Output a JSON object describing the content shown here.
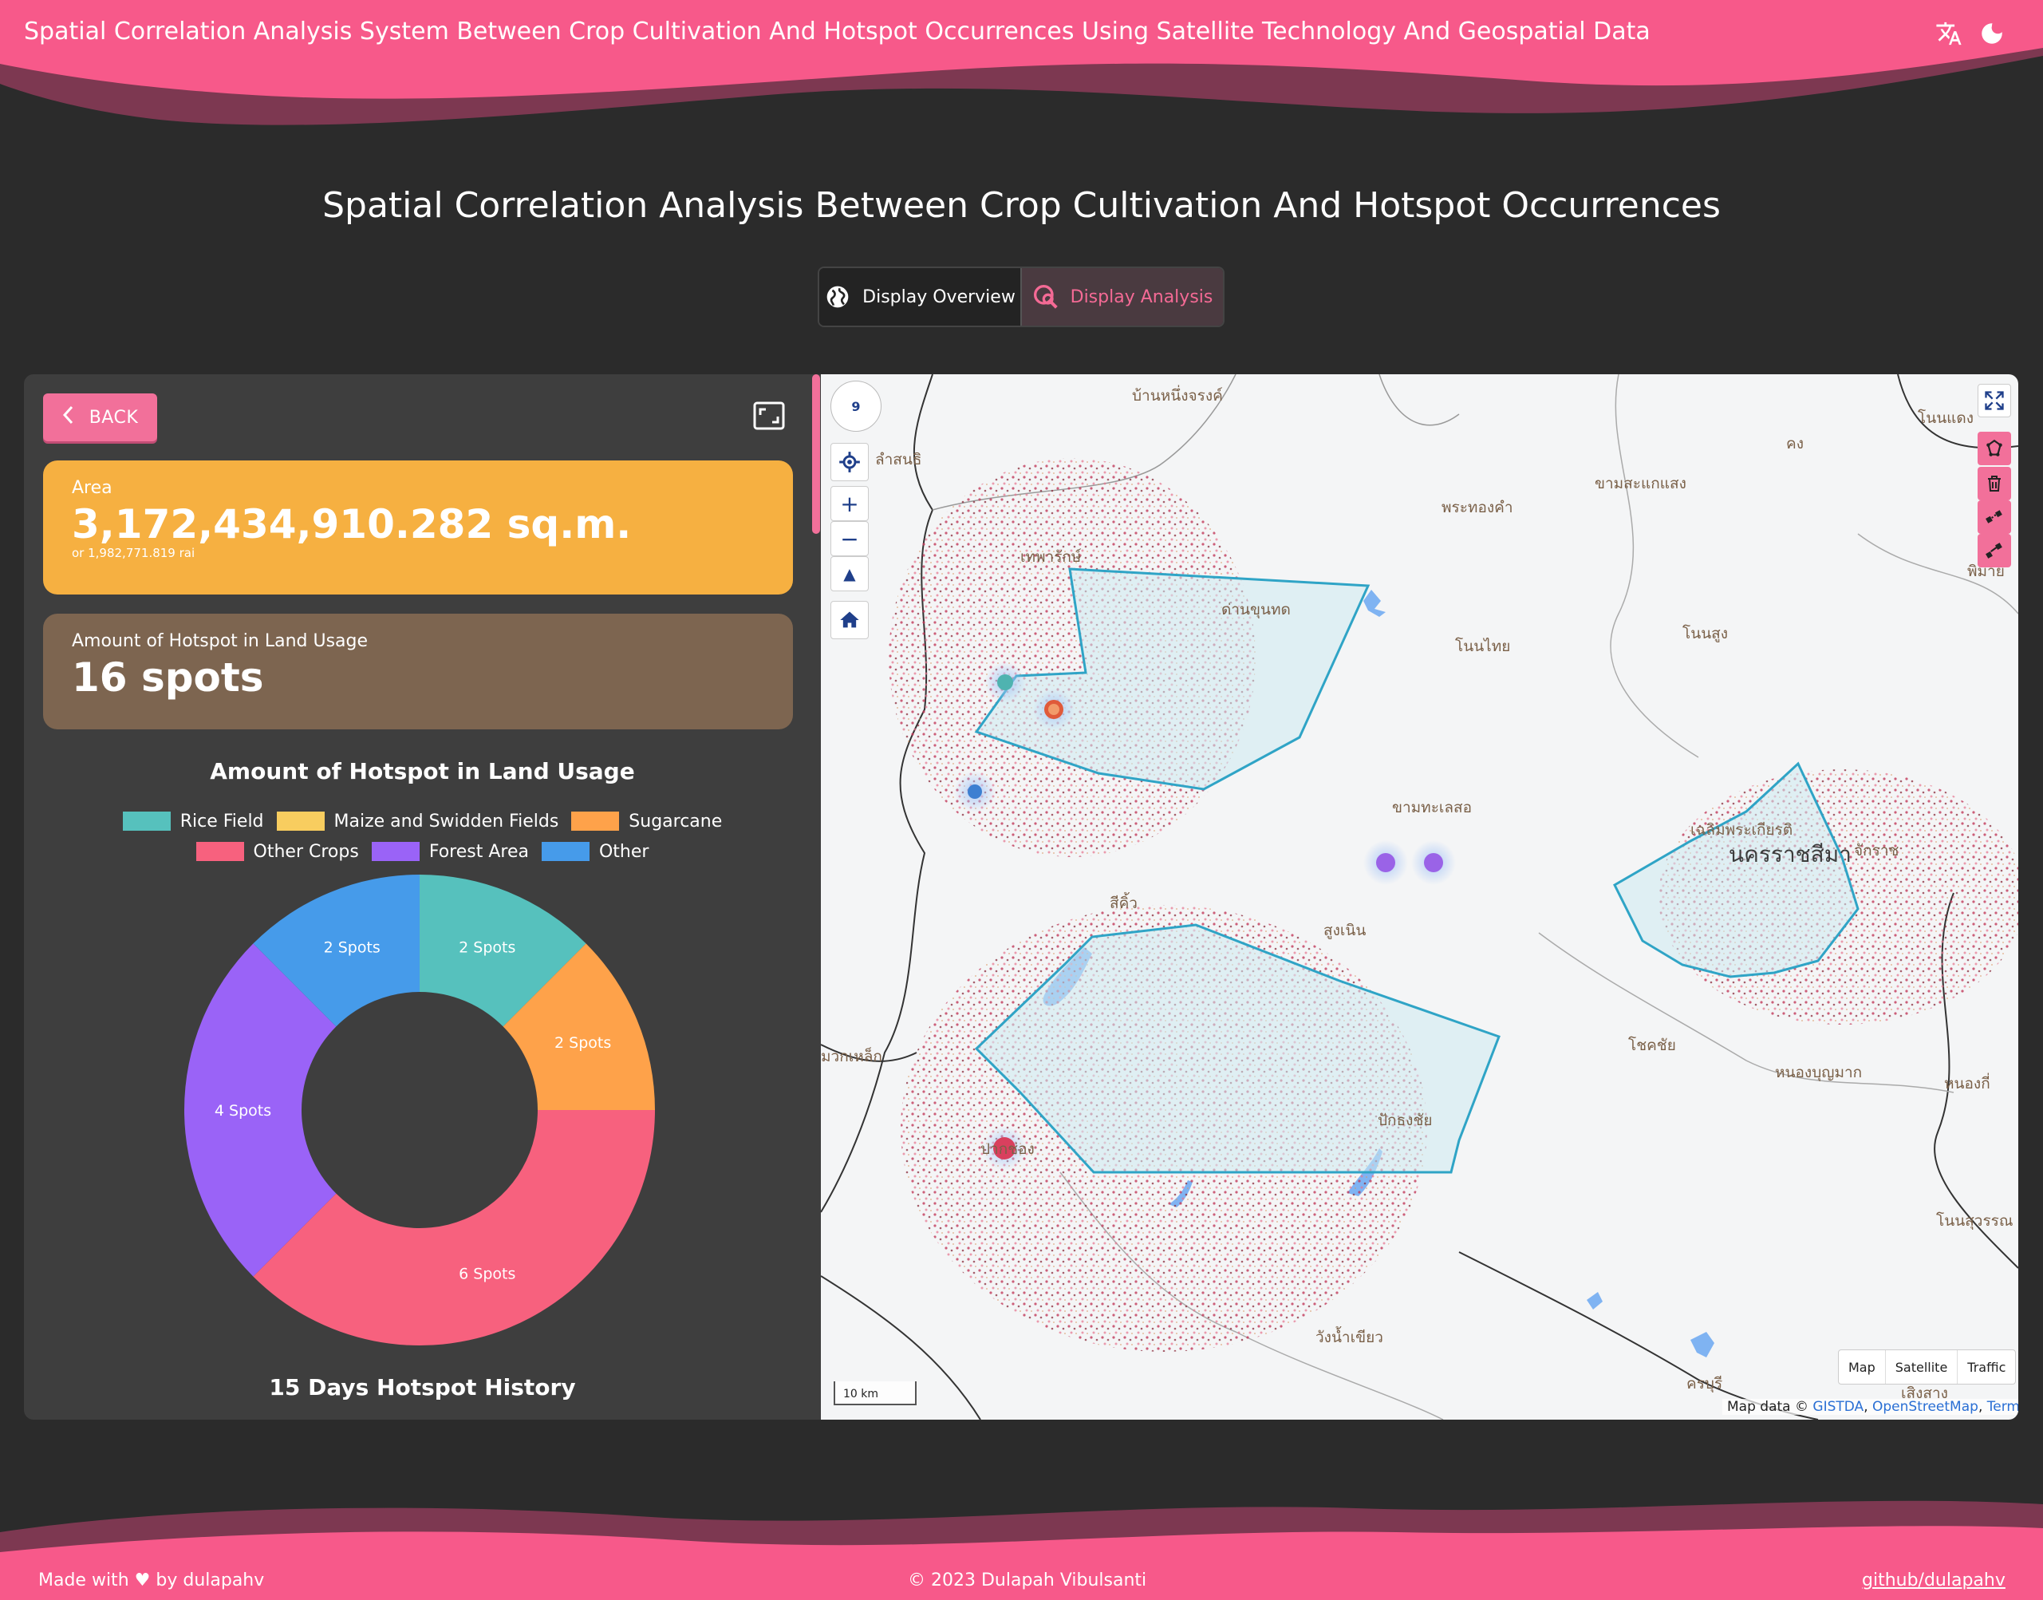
{
  "header": {
    "app_title": "Spatial Correlation Analysis System Between Crop Cultivation And Hotspot Occurrences Using Satellite Technology And Geospatial Data",
    "translate_icon": "translate-icon",
    "theme_icon": "moon-icon"
  },
  "page": {
    "title": "Spatial Correlation Analysis Between Crop Cultivation And Hotspot Occurrences",
    "tabs": [
      {
        "label": "Display Overview",
        "icon": "globe-icon",
        "active": false
      },
      {
        "label": "Display Analysis",
        "icon": "search-analysis-icon",
        "active": true
      }
    ]
  },
  "panel": {
    "back_label": "BACK",
    "area": {
      "label": "Area",
      "value": "3,172,434,910.282 sq.m.",
      "sub": "or 1,982,771.819 rai"
    },
    "hotspot": {
      "label": "Amount of Hotspot in Land Usage",
      "value": "16 spots"
    },
    "chart_title": "Amount of Hotspot in Land Usage",
    "history_title": "15 Days Hotspot History"
  },
  "chart_data": {
    "type": "pie",
    "title": "Amount of Hotspot in Land Usage",
    "donut": true,
    "legend_position": "top",
    "slices": [
      {
        "label": "Rice Field",
        "value": 2,
        "color": "#56c1bd",
        "text": "2 Spots"
      },
      {
        "label": "Maize and Swidden Fields",
        "value": 0,
        "color": "#f8cd5f",
        "text": ""
      },
      {
        "label": "Sugarcane",
        "value": 2,
        "color": "#fea24a",
        "text": "2 Spots"
      },
      {
        "label": "Other Crops",
        "value": 6,
        "color": "#f7617e",
        "text": "6 Spots"
      },
      {
        "label": "Forest Area",
        "value": 4,
        "color": "#9a63f7",
        "text": "4 Spots"
      },
      {
        "label": "Other",
        "value": 2,
        "color": "#469bea",
        "text": "2 Spots"
      }
    ]
  },
  "map": {
    "compass_zoom": "9",
    "labels": [
      {
        "text": "บ้านหนึ่งจรงค์",
        "cls": ""
      },
      {
        "text": "ลำสนธิ",
        "cls": ""
      },
      {
        "text": "เทพารักษ์",
        "cls": ""
      },
      {
        "text": "ด่านขุนทด",
        "cls": ""
      },
      {
        "text": "พระทองคำ",
        "cls": ""
      },
      {
        "text": "ขามสะแกแสง",
        "cls": ""
      },
      {
        "text": "คง",
        "cls": ""
      },
      {
        "text": "โนนแดง",
        "cls": ""
      },
      {
        "text": "พิมาย",
        "cls": ""
      },
      {
        "text": "โนนไทย",
        "cls": ""
      },
      {
        "text": "โนนสูง",
        "cls": ""
      },
      {
        "text": "ขามทะเลสอ",
        "cls": ""
      },
      {
        "text": "นครราชสีมา",
        "cls": "city"
      },
      {
        "text": "เฉลิมพระเกียรติ",
        "cls": ""
      },
      {
        "text": "จักราช",
        "cls": ""
      },
      {
        "text": "สีคิ้ว",
        "cls": ""
      },
      {
        "text": "สูงเนิน",
        "cls": ""
      },
      {
        "text": "โชคชัย",
        "cls": ""
      },
      {
        "text": "หนองบุญมาก",
        "cls": ""
      },
      {
        "text": "หนองกี่",
        "cls": ""
      },
      {
        "text": "มวกเหล็ก",
        "cls": ""
      },
      {
        "text": "ปากช่อง",
        "cls": ""
      },
      {
        "text": "ปักธงชัย",
        "cls": ""
      },
      {
        "text": "วังน้ำเขียว",
        "cls": ""
      },
      {
        "text": "โนนสุวรรณ",
        "cls": ""
      },
      {
        "text": "ครบุรี",
        "cls": ""
      },
      {
        "text": "เสิงสาง",
        "cls": ""
      }
    ],
    "layer_options": [
      "Map",
      "Satellite",
      "Traffic"
    ],
    "scale": "10 km",
    "attribution_prefix": "Map data © ",
    "attribution_links": [
      "GISTDA",
      "OpenStreetMap",
      "Terms"
    ]
  },
  "footer": {
    "made_with_prefix": "Made with",
    "made_with_suffix": "by dulapahv",
    "copyright": "© 2023 Dulapah Vibulsanti",
    "github": "github/dulapahv"
  },
  "colors": {
    "brand_pink": "#f2709a",
    "area_card": "#f6b041",
    "hotspot_card": "#7d6550",
    "background": "#2b2b2b",
    "panel": "#3e3e3e"
  }
}
